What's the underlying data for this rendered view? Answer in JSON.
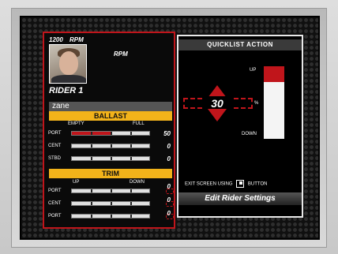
{
  "header": {
    "rpm_value": "1200",
    "rpm_unit": "RPM",
    "rpm_secondary_unit": "RPM"
  },
  "rider": {
    "label": "RIDER 1",
    "name": "zane",
    "portrait_icon": "rider-portrait"
  },
  "ballast": {
    "title": "BALLAST",
    "scale_min": "EMPTY",
    "scale_max": "FULL",
    "rows": [
      {
        "label": "PORT",
        "value": "50",
        "level": 0.5
      },
      {
        "label": "CENT",
        "value": "0",
        "level": 0
      },
      {
        "label": "STBD",
        "value": "0",
        "level": 0
      }
    ]
  },
  "trim": {
    "title": "TRIM",
    "scale_min": "UP",
    "scale_max": "DOWN",
    "rows": [
      {
        "label": "PORT",
        "value": "0",
        "level": 0
      },
      {
        "label": "CENT",
        "value": "0",
        "level": 0
      },
      {
        "label": "PORT",
        "value": "0",
        "level": 0
      }
    ]
  },
  "quicklist": {
    "title": "QUICKLIST ACTION",
    "value": "30",
    "up_label": "UP",
    "pct_label": "%",
    "down_label": "DOWN",
    "exit_prefix": "EXIT SCREEN USING",
    "exit_suffix": "BUTTON",
    "edit_button_label": "Edit Rider Settings"
  },
  "colors": {
    "accent_red": "#c0151b",
    "section_yellow": "#f2b31a",
    "panel_black": "#0a0a0a"
  }
}
